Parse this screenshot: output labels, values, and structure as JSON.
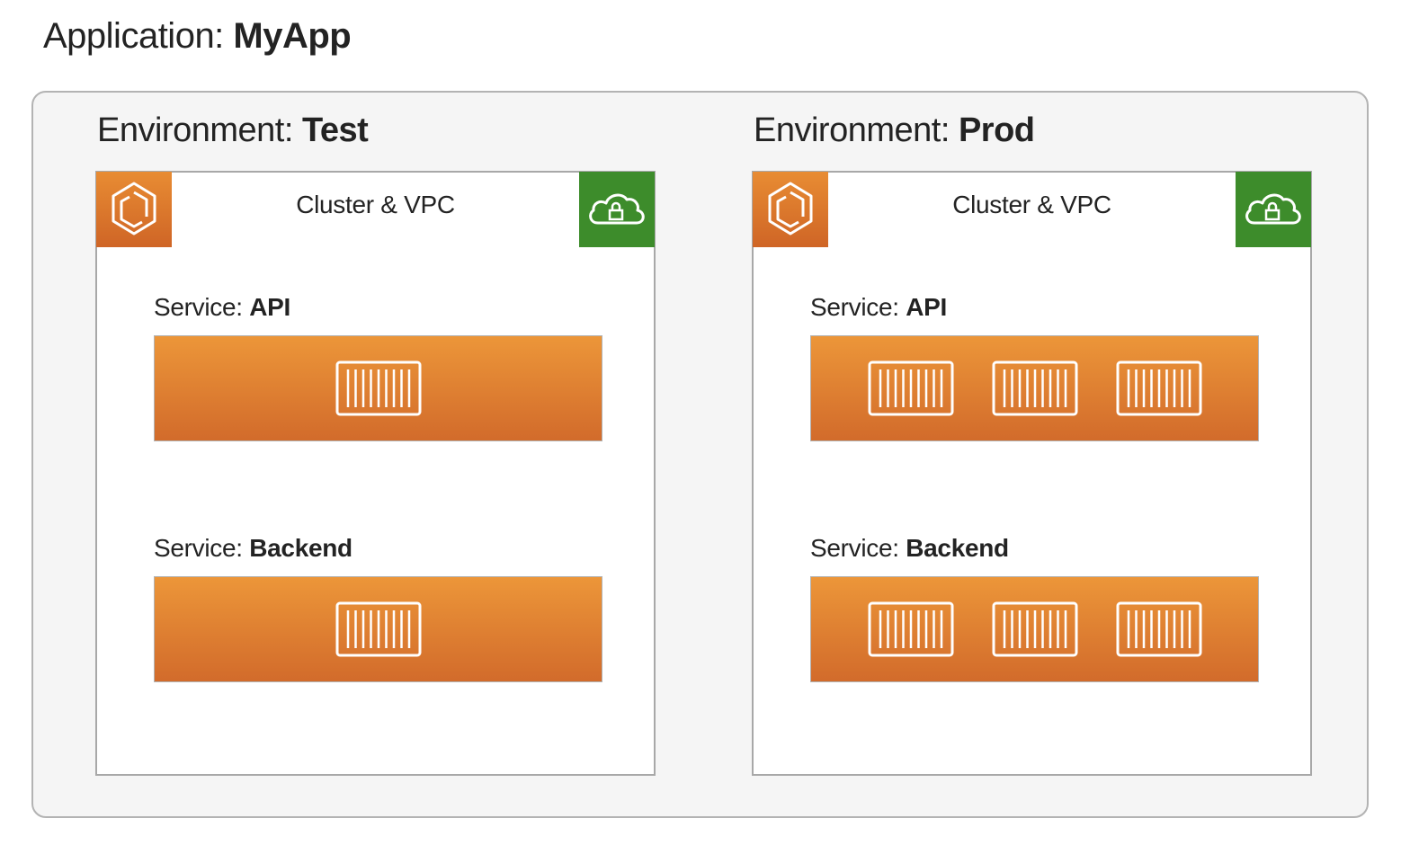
{
  "application": {
    "prefix": "Application: ",
    "name": "MyApp"
  },
  "environments": [
    {
      "prefix": "Environment: ",
      "name": "Test",
      "cluster_label": "Cluster & VPC",
      "cluster_icon": "ecs-cluster-icon",
      "vpc_icon": "vpc-cloud-lock-icon",
      "services": [
        {
          "prefix": "Service: ",
          "name": "API",
          "task_count": 1
        },
        {
          "prefix": "Service: ",
          "name": "Backend",
          "task_count": 1
        }
      ]
    },
    {
      "prefix": "Environment: ",
      "name": "Prod",
      "cluster_label": "Cluster & VPC",
      "cluster_icon": "ecs-cluster-icon",
      "vpc_icon": "vpc-cloud-lock-icon",
      "services": [
        {
          "prefix": "Service: ",
          "name": "API",
          "task_count": 3
        },
        {
          "prefix": "Service: ",
          "name": "Backend",
          "task_count": 3
        }
      ]
    }
  ],
  "colors": {
    "cluster_icon_bg": "#e07a30",
    "vpc_icon_bg": "#3d8c2b",
    "service_bar": "#e4832f",
    "app_border": "#b3b3b3"
  }
}
